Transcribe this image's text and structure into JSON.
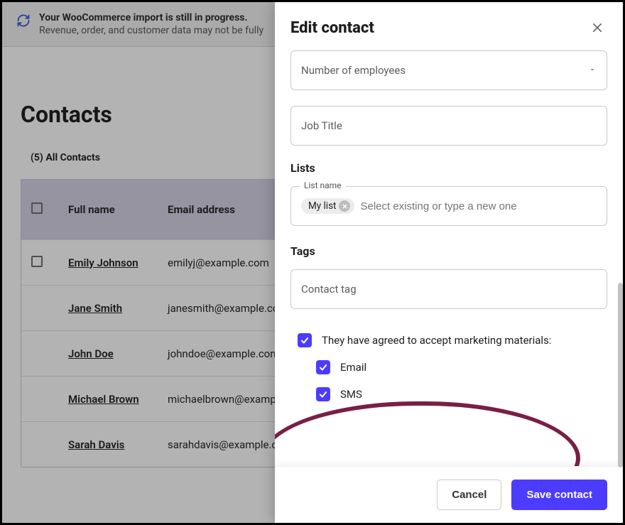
{
  "banner": {
    "title": "Your WooCommerce import is still in progress.",
    "subtitle": "Revenue, order, and customer data may not be fully"
  },
  "page": {
    "title": "Contacts",
    "subhead_count": "(5)",
    "subhead_label": "All Contacts"
  },
  "table": {
    "col_name": "Full name",
    "col_email": "Email address",
    "rows": [
      {
        "name": "Emily Johnson",
        "email": "emilyj@example.com",
        "show_chk": true
      },
      {
        "name": "Jane Smith",
        "email": "janesmith@example.com",
        "show_chk": false
      },
      {
        "name": "John Doe",
        "email": "johndoe@example.com",
        "show_chk": false
      },
      {
        "name": "Michael Brown",
        "email": "michaelbrown@example...",
        "show_chk": false
      },
      {
        "name": "Sarah Davis",
        "email": "sarahdavis@example.com",
        "show_chk": false
      }
    ]
  },
  "drawer": {
    "title": "Edit contact",
    "employees_label": "Number of employees",
    "job_title_placeholder": "Job Title",
    "lists_label": "Lists",
    "list_floating_label": "List name",
    "list_chip": "My list",
    "list_placeholder": "Select existing or type a new one",
    "tags_label": "Tags",
    "tag_placeholder": "Contact tag",
    "consent_main": "They have agreed to accept marketing materials:",
    "consent_email": "Email",
    "consent_sms": "SMS",
    "btn_cancel": "Cancel",
    "btn_save": "Save contact"
  }
}
